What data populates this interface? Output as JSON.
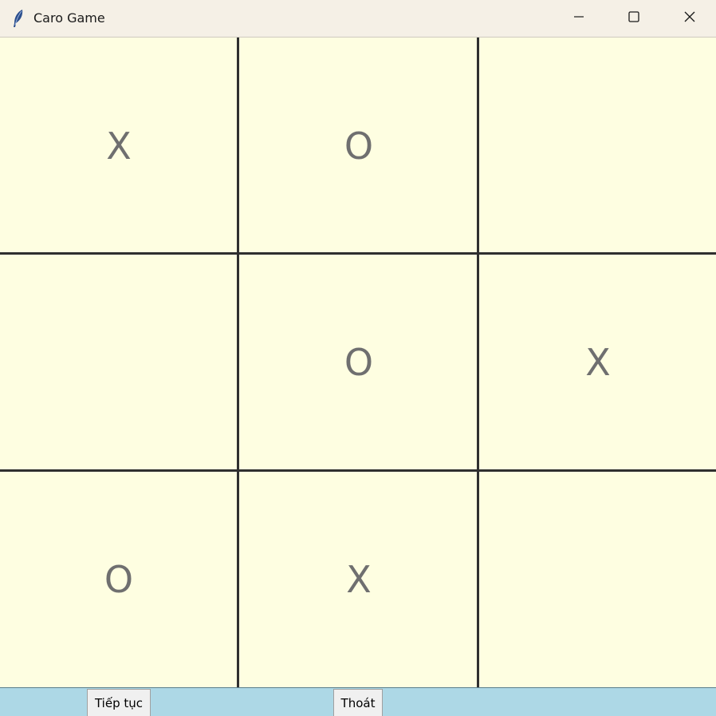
{
  "window": {
    "title": "Caro Game",
    "icon": "feather-icon"
  },
  "board": {
    "rows": [
      [
        "X",
        "O",
        ""
      ],
      [
        "",
        "O",
        "X"
      ],
      [
        "O",
        "X",
        ""
      ]
    ]
  },
  "buttons": {
    "continue_label": "Tiếp tục",
    "exit_label": "Thoát"
  },
  "colors": {
    "board_bg": "#fefee1",
    "grid_line": "#2f2f2f",
    "mark": "#6f6f6f",
    "bottom_bar": "#add8e6",
    "titlebar": "#f5f0e6"
  }
}
